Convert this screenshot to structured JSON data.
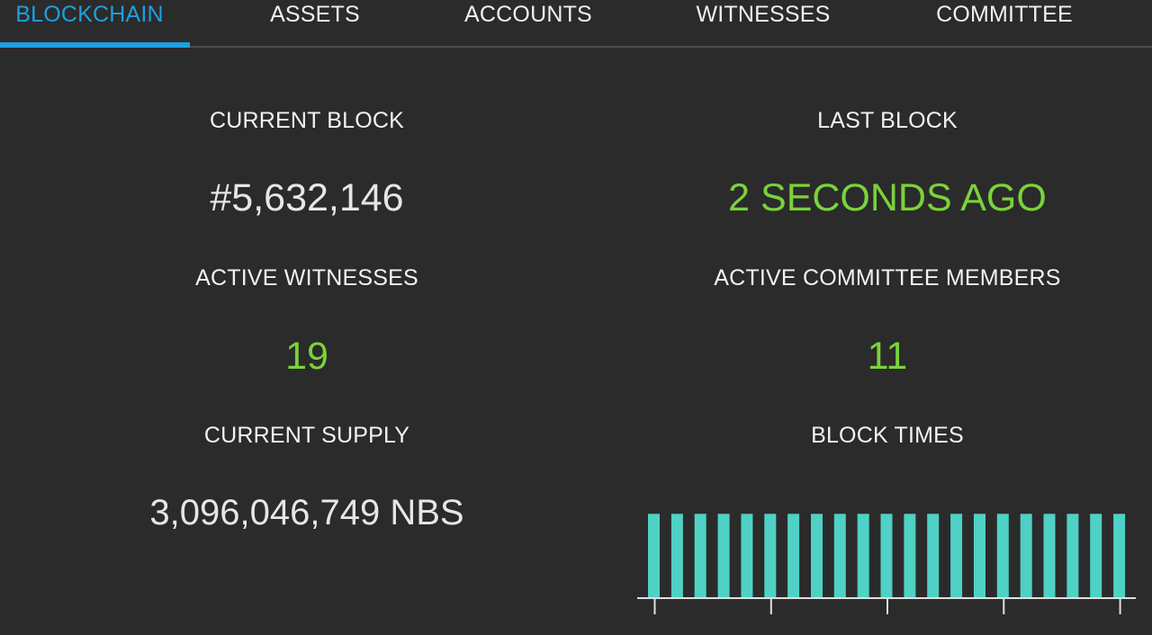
{
  "tabs": [
    {
      "label": "BLOCKCHAIN",
      "active": true
    },
    {
      "label": "ASSETS",
      "active": false
    },
    {
      "label": "ACCOUNTS",
      "active": false
    },
    {
      "label": "WITNESSES",
      "active": false
    },
    {
      "label": "COMMITTEE",
      "active": false
    }
  ],
  "stats": {
    "current_block": {
      "label": "CURRENT BLOCK",
      "value": "#5,632,146"
    },
    "last_block": {
      "label": "LAST BLOCK",
      "value": "2 SECONDS AGO"
    },
    "active_witnesses": {
      "label": "ACTIVE WITNESSES",
      "value": "19"
    },
    "active_committee": {
      "label": "ACTIVE COMMITTEE MEMBERS",
      "value": "11"
    },
    "current_supply": {
      "label": "CURRENT SUPPLY",
      "value": "3,096,046,749 NBS"
    },
    "block_times": {
      "label": "BLOCK TIMES"
    }
  },
  "colors": {
    "background": "#2b2b2b",
    "accent_blue": "#1e9fe0",
    "value_green": "#7ad33a",
    "bar_teal": "#4fd1c5",
    "axis": "#e0e0e0"
  },
  "chart_data": {
    "type": "bar",
    "values": [
      3,
      3,
      3,
      3,
      3,
      3,
      3,
      3,
      3,
      3,
      3,
      3,
      3,
      3,
      3,
      3,
      3,
      3,
      3,
      3,
      3
    ],
    "title": "BLOCK TIMES",
    "xlabel": "",
    "ylabel": "",
    "ylim": [
      0,
      3.2
    ]
  }
}
